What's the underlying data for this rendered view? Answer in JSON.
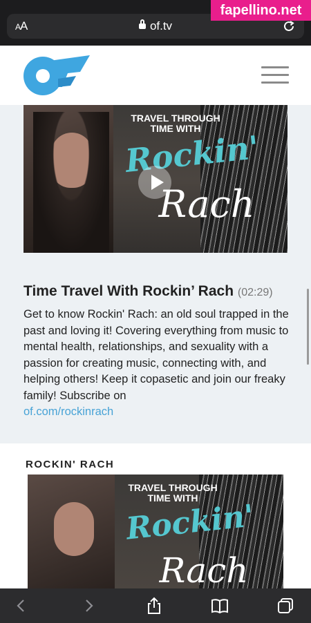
{
  "browser": {
    "text_size_label_small": "A",
    "text_size_label_large": "A",
    "url": "of.tv"
  },
  "watermark": "fapellino.net",
  "video": {
    "thumbnail_top_text": "TRAVEL THROUGH TIME WITH",
    "thumbnail_script_1": "Rockin'",
    "thumbnail_script_2": "Rach",
    "title": "Time Travel With Rockin’ Rach",
    "duration": "(02:29)",
    "description": "Get to know Rockin' Rach: an old soul trapped in the past and loving it! Covering everything from music to mental health, relationships, and sexuality with a passion for creating music, connecting with, and helping others! Keep it copasetic and join our freaky family! Subscribe on",
    "link": "of.com/rockinrach"
  },
  "section2": {
    "label": "ROCKIN' RACH",
    "thumbnail_top_text": "TRAVEL THROUGH TIME WITH",
    "thumbnail_script_1": "Rockin'",
    "thumbnail_script_2": "Rach"
  },
  "colors": {
    "accent": "#48a3d6",
    "logo_blue": "#3fa6e0",
    "content_bg": "#edf1f4"
  },
  "icons": {
    "back": "chevron-left-icon",
    "forward": "chevron-right-icon",
    "share": "share-icon",
    "bookmarks": "book-icon",
    "tabs": "tabs-icon"
  }
}
